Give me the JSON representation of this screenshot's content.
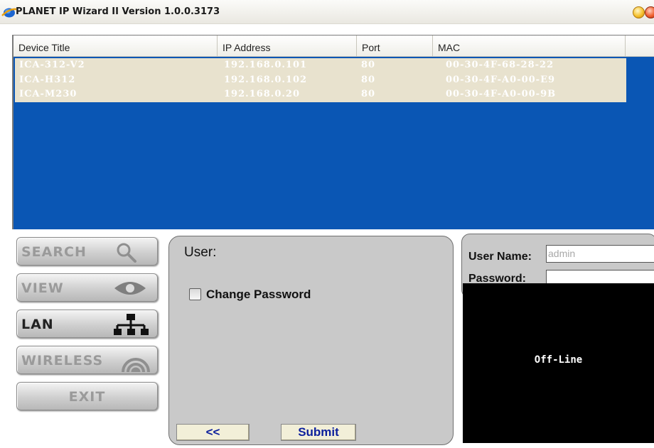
{
  "window": {
    "title": "PLANET IP Wizard II  Version 1.0.0.3173"
  },
  "device_list": {
    "columns": [
      "Device Title",
      "IP Address",
      "Port",
      "MAC"
    ],
    "rows": [
      {
        "title": "ICA-312-V2",
        "ip": "192.168.0.101",
        "port": "80",
        "mac": "00-30-4F-68-28-22"
      },
      {
        "title": "ICA-H312",
        "ip": "192.168.0.102",
        "port": "80",
        "mac": "00-30-4F-A0-00-E9"
      },
      {
        "title": "ICA-M230",
        "ip": "192.168.0.20",
        "port": "80",
        "mac": "00-30-4F-A0-00-9B"
      }
    ],
    "background_color": "#0a56b4",
    "row_color": "#e8e2ce"
  },
  "nav": {
    "search": "SEARCH",
    "view": "VIEW",
    "lan": "LAN",
    "wireless": "WIRELESS",
    "exit": "EXIT"
  },
  "user_panel": {
    "heading": "User:",
    "change_password_label": "Change Password",
    "change_password_checked": false,
    "back_button": "<<",
    "submit_button": "Submit"
  },
  "login": {
    "username_label": "User Name:",
    "username_value": "admin",
    "password_label": "Password:",
    "password_value": ""
  },
  "video": {
    "status": "Off-Line"
  },
  "colors": {
    "button_text": "#0c1f9c",
    "panel_gray": "#c9c9c9"
  }
}
